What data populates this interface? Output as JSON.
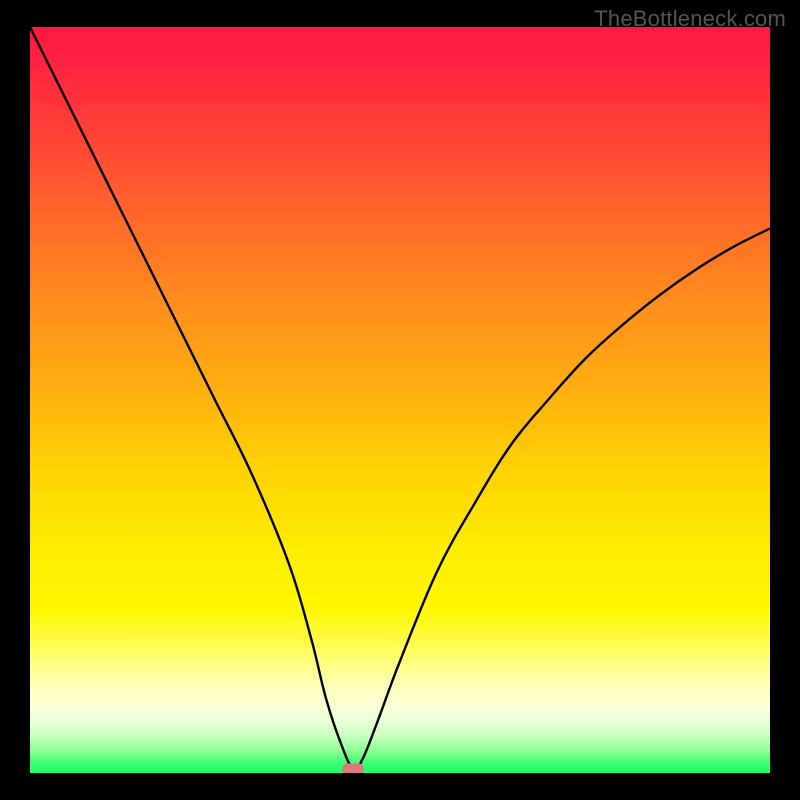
{
  "watermark": "TheBottleneck.com",
  "colors": {
    "page_bg": "#000000",
    "curve_stroke": "#000000",
    "marker_fill": "#db7a7c",
    "watermark_color": "#555555"
  },
  "chart_data": {
    "type": "line",
    "title": "",
    "xlabel": "",
    "ylabel": "",
    "xlim": [
      0,
      100
    ],
    "ylim": [
      0,
      100
    ],
    "grid": false,
    "legend": false,
    "series": [
      {
        "name": "bottleneck_curve",
        "x": [
          0,
          5,
          10,
          15,
          20,
          25,
          30,
          35,
          38,
          40,
          42,
          43.7,
          45,
          47,
          50,
          55,
          60,
          65,
          70,
          75,
          80,
          85,
          90,
          95,
          100
        ],
        "values": [
          100,
          90,
          80,
          70,
          60,
          50,
          40,
          28,
          18,
          10,
          4,
          0.5,
          2,
          7,
          15,
          27,
          36,
          44,
          50,
          55.5,
          60,
          64,
          67.5,
          70.5,
          73
        ]
      }
    ],
    "marker": {
      "x": 43.7,
      "y": 0.5
    },
    "background_gradient_description": "vertical rainbow gradient from red (top, high bottleneck) through orange and yellow to green (bottom, low bottleneck)"
  }
}
